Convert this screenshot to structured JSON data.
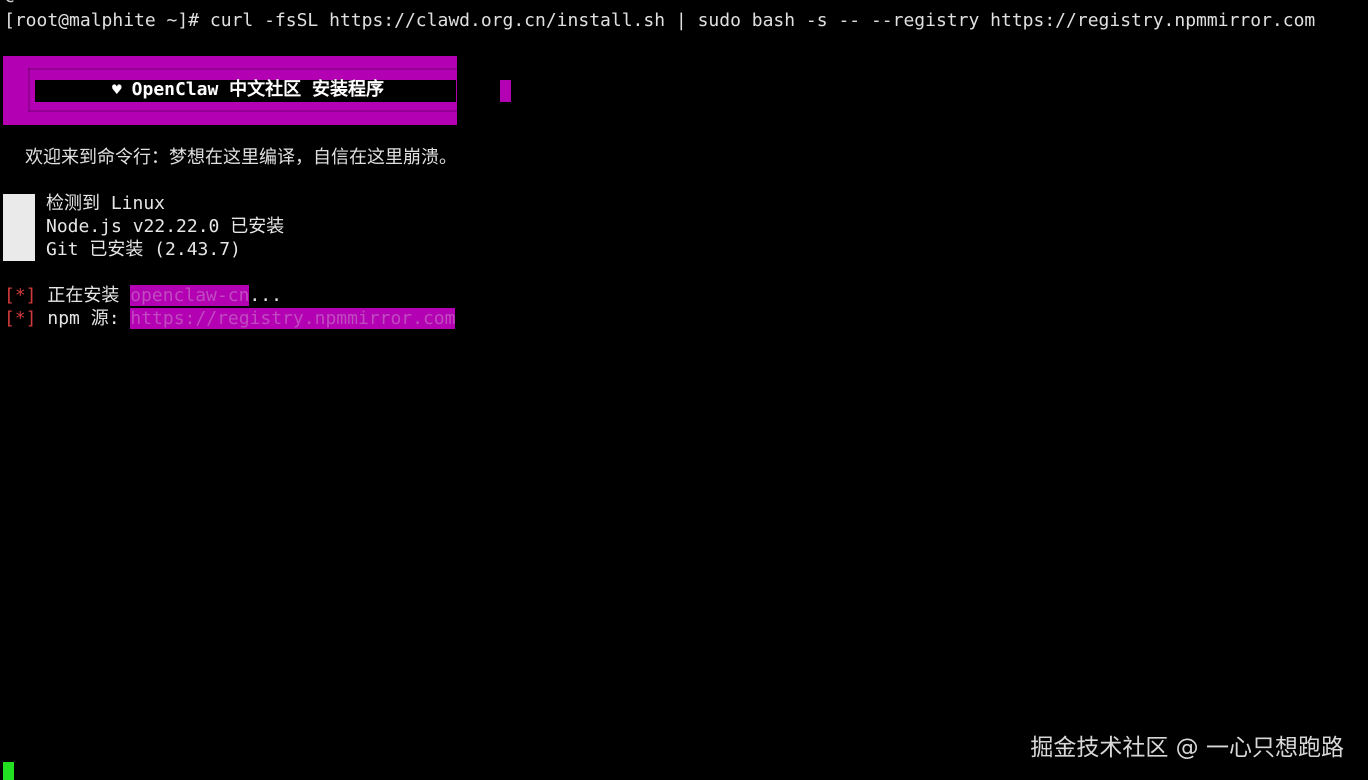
{
  "terminal": {
    "top_fragment": "c",
    "command": "[root@malphite ~]# curl -fsSL https://clawd.org.cn/install.sh | sudo bash -s -- --registry https://registry.npmmirror.com",
    "banner_title": "OpenClaw 中文社区 安装程序",
    "banner_icon": "heart-icon",
    "welcome": "欢迎来到命令行：梦想在这里编译，自信在这里崩溃。",
    "detect": [
      "检测到 Linux",
      "Node.js v22.22.0 已安装",
      "Git 已安装 (2.43.7)"
    ],
    "install_bracket": "[*]",
    "install_label": " 正在安装 ",
    "install_target": "openclaw-cn",
    "install_suffix": "...",
    "npm_bracket": "[*]",
    "npm_label": " npm 源: ",
    "npm_url": "https://registry.npmmirror.com"
  },
  "watermark": "掘金技术社区 @ 一心只想跑路",
  "colors": {
    "background": "#000000",
    "banner": "#b300b3",
    "bracket": "#d23b3b",
    "cursor": "#22e022"
  }
}
